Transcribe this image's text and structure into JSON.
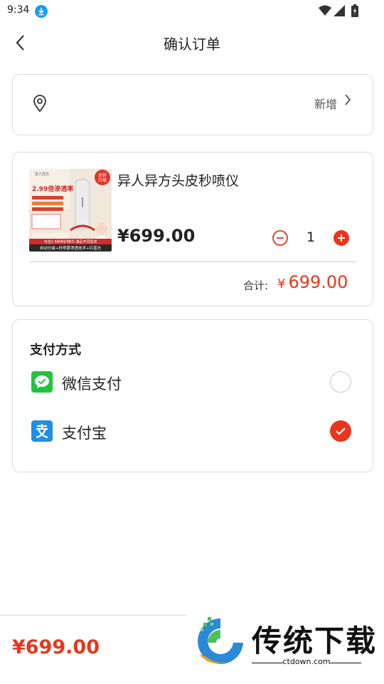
{
  "status_bar": {
    "time": "9:34"
  },
  "header": {
    "title": "确认订单"
  },
  "address": {
    "add_label": "新增"
  },
  "product": {
    "name": "异人异方头皮秒喷仪",
    "price": "¥699.00",
    "quantity": "1",
    "total_label": "合计:",
    "total_currency": "¥",
    "total_value": "699.00",
    "thumbnail": {
      "corner_badge_line1": "全新",
      "corner_badge_line2": "升级",
      "headline": "2.99倍渗透率",
      "brand_text": "异人异方",
      "banner_top": "可选1-6种养护精华·满足不同需求",
      "banner_bottom": "自动分装+秒喷雾渗透技术+红蓝光"
    }
  },
  "payment": {
    "title": "支付方式",
    "options": [
      {
        "label": "微信支付",
        "selected": false
      },
      {
        "label": "支付宝",
        "selected": true
      }
    ]
  },
  "bottom_bar": {
    "price": "¥699.00"
  },
  "watermark": {
    "name": "传统下载",
    "url": "ctdown.com"
  },
  "colors": {
    "accent": "#e8361c",
    "wechat": "#22c33d",
    "alipay": "#1f8fe6",
    "download_badge": "#1e9bf0"
  }
}
